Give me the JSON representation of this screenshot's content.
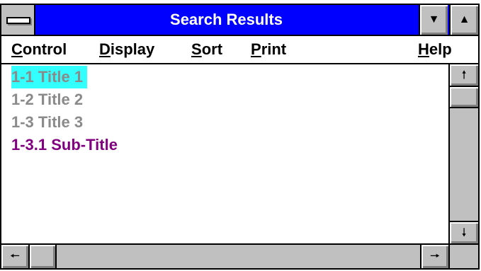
{
  "window": {
    "title": "Search Results",
    "colors": {
      "titlebar": "#0000ff",
      "title_text": "#ffffff",
      "chrome": "#c0c0c0",
      "selected_bg": "#33ffff"
    }
  },
  "controls": {
    "system_menu_icon": "system-menu-bar-icon",
    "minimize_glyph": "▼",
    "maximize_glyph": "▲"
  },
  "menubar": {
    "items": [
      {
        "accel": "C",
        "rest": "ontrol"
      },
      {
        "accel": "D",
        "rest": "isplay"
      },
      {
        "accel": "S",
        "rest": "ort"
      },
      {
        "accel": "P",
        "rest": "rint"
      },
      {
        "accel": "H",
        "rest": "elp"
      }
    ]
  },
  "results": {
    "items": [
      {
        "text": "1-1 Title 1",
        "state": "selected",
        "color": "#8a8a8a"
      },
      {
        "text": "1-2 Title 2",
        "state": "visited",
        "color": "#8a8a8a"
      },
      {
        "text": "1-3 Title 3",
        "state": "visited",
        "color": "#8a8a8a"
      },
      {
        "text": "1-3.1 Sub-Title",
        "state": "unvisited",
        "color": "#800080"
      }
    ]
  },
  "scrollbars": {
    "up_glyph": "🠕",
    "down_glyph": "🠗",
    "left_glyph": "🠔",
    "right_glyph": "🠖"
  }
}
